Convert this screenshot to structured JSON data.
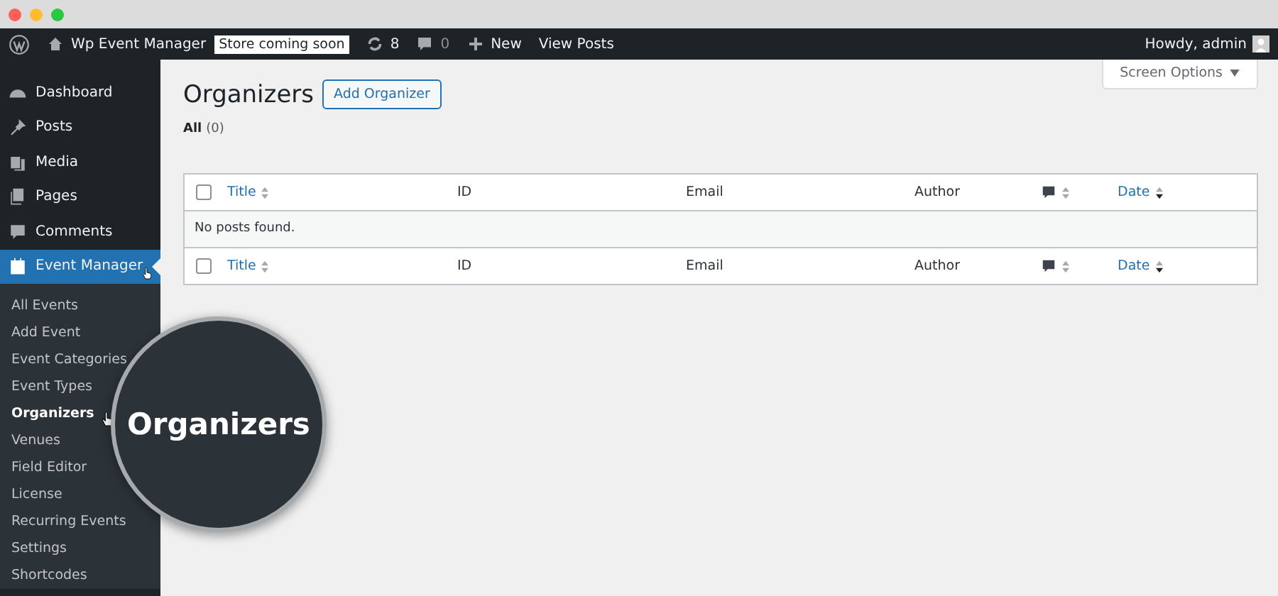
{
  "admin_bar": {
    "site_name": "Wp Event Manager",
    "store_badge": "Store coming soon",
    "updates": "8",
    "comments": "0",
    "new": "New",
    "view_posts": "View Posts",
    "greeting": "Howdy, admin"
  },
  "sidebar": {
    "items": [
      {
        "label": "Dashboard",
        "selected": false
      },
      {
        "label": "Posts",
        "selected": false
      },
      {
        "label": "Media",
        "selected": false
      },
      {
        "label": "Pages",
        "selected": false
      },
      {
        "label": "Comments",
        "selected": false
      },
      {
        "label": "Event Manager",
        "selected": true,
        "children": [
          {
            "label": "All Events",
            "selected": false
          },
          {
            "label": "Add Event",
            "selected": false
          },
          {
            "label": "Event Categories",
            "selected": false
          },
          {
            "label": "Event Types",
            "selected": false
          },
          {
            "label": "Organizers",
            "selected": true
          },
          {
            "label": "Venues",
            "selected": false
          },
          {
            "label": "Field Editor",
            "selected": false
          },
          {
            "label": "License",
            "selected": false
          },
          {
            "label": "Recurring Events",
            "selected": false
          },
          {
            "label": "Settings",
            "selected": false
          },
          {
            "label": "Shortcodes",
            "selected": false
          }
        ]
      }
    ]
  },
  "screen_options": "Screen Options",
  "page": {
    "title": "Organizers",
    "add_button": "Add Organizer",
    "filter_label": "All",
    "filter_count": "(0)"
  },
  "table": {
    "header": {
      "checked": false,
      "columns": [
        {
          "label": "Title",
          "kind": "link",
          "sorted": false
        },
        {
          "label": "ID",
          "kind": "text"
        },
        {
          "label": "Email",
          "kind": "text"
        },
        {
          "label": "Author",
          "kind": "text"
        },
        {
          "kind": "comments",
          "sorted": false
        },
        {
          "label": "Date",
          "kind": "link",
          "sorted": true
        }
      ]
    },
    "empty_message": "No posts found.",
    "footer": {
      "checked": false,
      "columns": [
        {
          "label": "Title",
          "kind": "link",
          "sorted": false
        },
        {
          "label": "ID",
          "kind": "text"
        },
        {
          "label": "Email",
          "kind": "text"
        },
        {
          "label": "Author",
          "kind": "text"
        },
        {
          "kind": "comments",
          "sorted": false
        },
        {
          "label": "Date",
          "kind": "link",
          "sorted": true
        }
      ]
    }
  },
  "magnifier": {
    "label": "Organizers"
  }
}
